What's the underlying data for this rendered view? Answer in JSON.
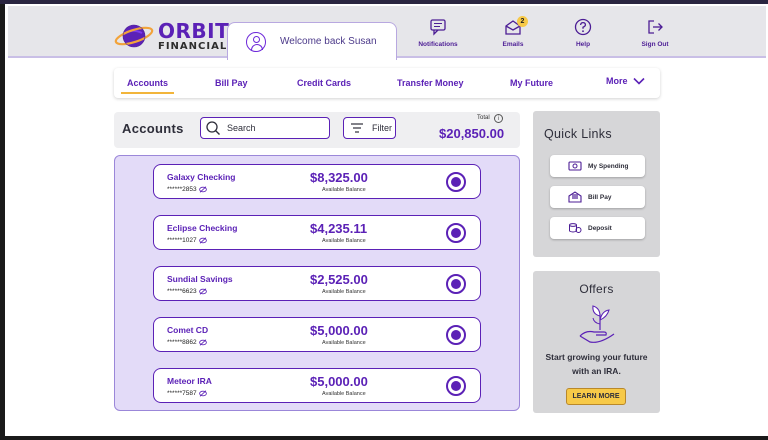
{
  "brand": {
    "name_line1": "ORBIT",
    "name_line2": "FINANCIAL",
    "logo_icon": "planet-icon"
  },
  "header": {
    "welcome_text": "Welcome back Susan",
    "actions": [
      {
        "label": "Notifications",
        "icon": "notifications-icon"
      },
      {
        "label": "Emails",
        "icon": "email-icon",
        "badge": "2"
      },
      {
        "label": "Help",
        "icon": "help-icon"
      },
      {
        "label": "Sign Out",
        "icon": "sign-out-icon"
      }
    ]
  },
  "nav": {
    "items": [
      "Accounts",
      "Bill Pay",
      "Credit Cards",
      "Transfer Money",
      "My Future"
    ],
    "active": "Accounts",
    "more_label": "More"
  },
  "accounts_header": {
    "title": "Accounts",
    "search_placeholder": "Search",
    "filter_label": "Filter",
    "total_label": "Total",
    "total_value": "$20,850.00"
  },
  "accounts": [
    {
      "name": "Galaxy Checking",
      "number": "******2853",
      "balance": "$8,325.00",
      "balance_label": "Available Balance"
    },
    {
      "name": "Eclipse Checking",
      "number": "******1027",
      "balance": "$4,235.11",
      "balance_label": "Available Balance"
    },
    {
      "name": "Sundial Savings",
      "number": "******6623",
      "balance": "$2,525.00",
      "balance_label": "Available Balance"
    },
    {
      "name": "Comet CD",
      "number": "******8862",
      "balance": "$5,000.00",
      "balance_label": "Available Balance"
    },
    {
      "name": "Meteor IRA",
      "number": "******7587",
      "balance": "$5,000.00",
      "balance_label": "Available Balance"
    }
  ],
  "quick_links": {
    "title": "Quick Links",
    "items": [
      {
        "label": "My Spending",
        "icon": "spending-icon"
      },
      {
        "label": "Bill Pay",
        "icon": "bill-pay-icon"
      },
      {
        "label": "Deposit",
        "icon": "deposit-icon"
      }
    ]
  },
  "offers": {
    "title": "Offers",
    "text": "Start growing your future with an IRA.",
    "button_label": "LEARN MORE",
    "illustration": "growing-plant-hand-icon"
  },
  "colors": {
    "primary": "#5b21b6",
    "panel_bg": "#e3dbf8",
    "accent": "#f7c948",
    "sidebar_card": "#d6d6d8"
  }
}
